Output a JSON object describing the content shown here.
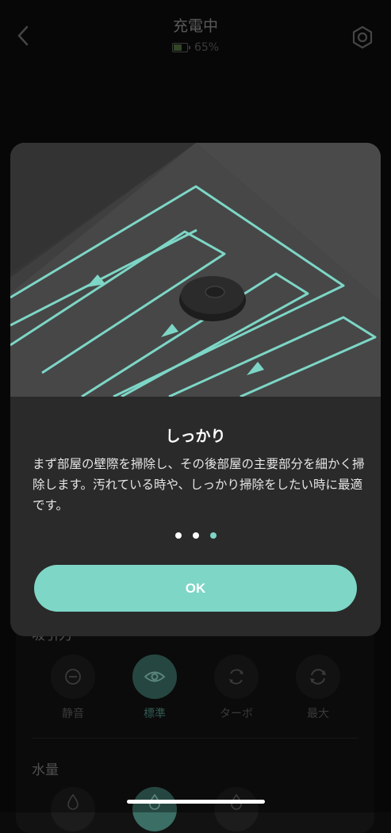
{
  "header": {
    "title": "充電中",
    "battery_percent_text": "65%",
    "battery_level": 0.65
  },
  "sections": {
    "suction_label_partial": "吸引力",
    "water_label": "水量"
  },
  "suction_modes": [
    {
      "label": "静音",
      "icon": "quiet-mode-icon",
      "active": false
    },
    {
      "label": "標準",
      "icon": "standard-mode-icon",
      "active": true
    },
    {
      "label": "ターボ",
      "icon": "turbo-mode-icon",
      "active": false
    },
    {
      "label": "最大",
      "icon": "max-mode-icon",
      "active": false
    }
  ],
  "modal": {
    "title": "しっかり",
    "description": "まず部屋の壁際を掃除し、その後部屋の主要部分を細かく掃除します。汚れている時や、しっかり掃除をしたい時に最適です。",
    "page_count": 3,
    "current_page": 3,
    "ok_label": "OK"
  },
  "colors": {
    "accent": "#7dd6c6",
    "modal_bg": "#2a2a2a",
    "page_bg": "#0b0b0b"
  }
}
